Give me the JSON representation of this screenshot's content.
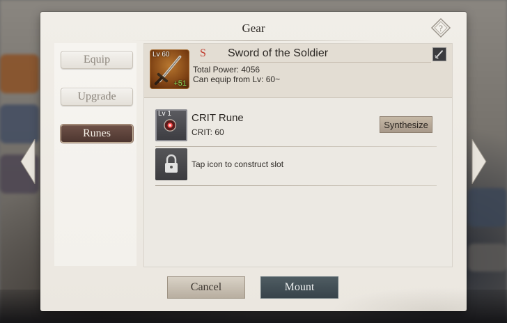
{
  "dialog": {
    "title": "Gear"
  },
  "tabs": [
    {
      "label": "Equip",
      "active": false
    },
    {
      "label": "Upgrade",
      "active": false
    },
    {
      "label": "Runes",
      "active": true
    }
  ],
  "gear": {
    "level": "Lv 60",
    "enhance": "+51",
    "grade": "S",
    "name": "Sword of the Soldier",
    "total_power": "Total Power: 4056",
    "equip_level": "Can equip from Lv: 60~"
  },
  "runes": [
    {
      "level": "Lv 1",
      "name": "CRIT Rune",
      "stat": "CRIT: 60",
      "action_label": "Synthesize"
    }
  ],
  "locked_slot": {
    "text": "Tap icon to construct slot"
  },
  "buttons": {
    "cancel": "Cancel",
    "mount": "Mount"
  },
  "colors": {
    "active_tab": "#4d3630",
    "grade": "#c0392b",
    "mount": "#37434a",
    "enhance": "#8be05a"
  }
}
